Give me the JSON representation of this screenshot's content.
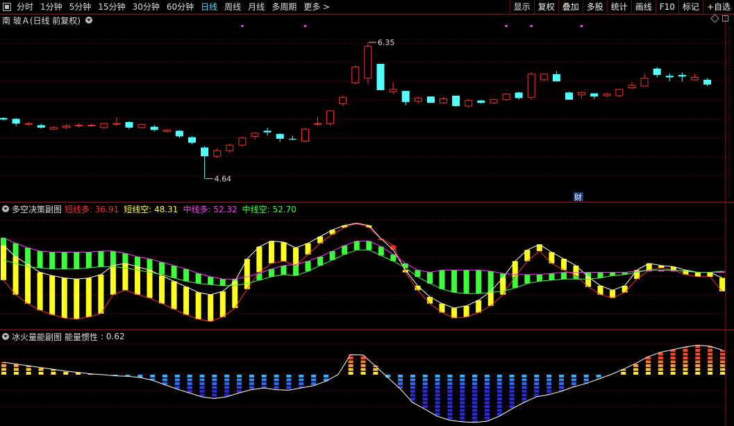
{
  "toolbar": {
    "periods": [
      "分时",
      "1分钟",
      "5分钟",
      "15分钟",
      "30分钟",
      "60分钟",
      "日线",
      "周线",
      "月线",
      "多周期",
      "更多 >"
    ],
    "active": "日线",
    "right_buttons": [
      "显示",
      "复权",
      "叠加",
      "多股",
      "统计",
      "画线",
      "F10",
      "标记",
      "+自选"
    ]
  },
  "main": {
    "title": "南 玻Ａ(日线 前复权)",
    "high_label": "6.35",
    "low_label": "4.64",
    "cai_label": "财",
    "colors": {
      "up": "#ff3232",
      "down": "#54ffff",
      "grid": "#7a1818"
    },
    "ylim": [
      4.4,
      6.55
    ],
    "candles": [
      [
        5.4,
        5.38,
        5.41,
        5.37
      ],
      [
        5.39,
        5.33,
        5.4,
        5.3
      ],
      [
        5.33,
        5.33,
        5.35,
        5.3
      ],
      [
        5.31,
        5.28,
        5.33,
        5.27
      ],
      [
        5.26,
        5.28,
        5.3,
        5.25
      ],
      [
        5.28,
        5.3,
        5.32,
        5.26
      ],
      [
        5.31,
        5.31,
        5.34,
        5.28
      ],
      [
        5.31,
        5.31,
        5.33,
        5.29
      ],
      [
        5.28,
        5.33,
        5.34,
        5.26
      ],
      [
        5.33,
        5.33,
        5.41,
        5.3
      ],
      [
        5.35,
        5.28,
        5.36,
        5.26
      ],
      [
        5.28,
        5.32,
        5.33,
        5.27
      ],
      [
        5.29,
        5.25,
        5.31,
        5.23
      ],
      [
        5.23,
        5.25,
        5.26,
        5.22
      ],
      [
        5.24,
        5.17,
        5.25,
        5.15
      ],
      [
        5.16,
        5.09,
        5.17,
        5.07
      ],
      [
        5.03,
        4.92,
        5.05,
        4.64
      ],
      [
        4.92,
        4.99,
        5.02,
        4.9
      ],
      [
        4.99,
        5.06,
        5.08,
        4.96
      ],
      [
        5.06,
        5.15,
        5.17,
        5.04
      ],
      [
        5.17,
        5.21,
        5.22,
        5.13
      ],
      [
        5.24,
        5.22,
        5.28,
        5.18
      ],
      [
        5.2,
        5.14,
        5.21,
        5.1
      ],
      [
        5.14,
        5.13,
        5.18,
        5.12
      ],
      [
        5.11,
        5.26,
        5.28,
        5.1
      ],
      [
        5.33,
        5.33,
        5.42,
        5.3
      ],
      [
        5.33,
        5.49,
        5.49,
        5.3
      ],
      [
        5.58,
        5.66,
        5.68,
        5.55
      ],
      [
        5.84,
        6.04,
        6.06,
        5.82
      ],
      [
        5.9,
        6.3,
        6.35,
        5.82
      ],
      [
        6.08,
        5.75,
        6.08,
        5.75
      ],
      [
        5.73,
        5.76,
        5.85,
        5.7
      ],
      [
        5.74,
        5.6,
        5.74,
        5.56
      ],
      [
        5.61,
        5.65,
        5.67,
        5.58
      ],
      [
        5.67,
        5.59,
        5.67,
        5.59
      ],
      [
        5.59,
        5.64,
        5.66,
        5.58
      ],
      [
        5.68,
        5.55,
        5.68,
        5.54
      ],
      [
        5.55,
        5.62,
        5.64,
        5.53
      ],
      [
        5.62,
        5.59,
        5.63,
        5.58
      ],
      [
        5.59,
        5.63,
        5.64,
        5.58
      ],
      [
        5.63,
        5.7,
        5.71,
        5.62
      ],
      [
        5.72,
        5.65,
        5.73,
        5.63
      ],
      [
        5.66,
        5.95,
        5.98,
        5.63
      ],
      [
        5.88,
        5.95,
        5.96,
        5.86
      ],
      [
        5.95,
        5.86,
        5.99,
        5.86
      ],
      [
        5.72,
        5.63,
        5.73,
        5.63
      ],
      [
        5.69,
        5.72,
        5.73,
        5.64
      ],
      [
        5.71,
        5.67,
        5.71,
        5.64
      ],
      [
        5.68,
        5.7,
        5.72,
        5.66
      ],
      [
        5.68,
        5.76,
        5.77,
        5.66
      ],
      [
        5.78,
        5.81,
        5.85,
        5.76
      ],
      [
        5.8,
        5.9,
        5.96,
        5.8
      ],
      [
        6.02,
        5.94,
        6.04,
        5.91
      ],
      [
        5.93,
        5.91,
        5.96,
        5.86
      ],
      [
        5.94,
        5.92,
        5.97,
        5.86
      ],
      [
        5.88,
        5.91,
        5.95,
        5.87
      ],
      [
        5.88,
        5.82,
        5.9,
        5.8
      ]
    ],
    "marks": [
      19,
      24,
      40,
      42,
      46
    ]
  },
  "dk": {
    "title": "多空决策副图",
    "legend": [
      {
        "name": "短线多",
        "value": "36.91",
        "color": "#ff3232"
      },
      {
        "name": "短线空",
        "value": "48.31",
        "color": "#ffff3c"
      },
      {
        "name": "中线多",
        "value": "52.32",
        "color": "#ff3cff"
      },
      {
        "name": "中线空",
        "value": "52.70",
        "color": "#3cff3c"
      }
    ],
    "ylim": [
      0,
      100
    ],
    "s1": [
      43,
      30,
      22,
      16,
      12,
      9,
      8,
      10,
      13,
      30,
      34,
      30,
      27,
      22,
      17,
      12,
      8,
      6,
      10,
      18,
      35,
      50,
      58,
      60,
      56,
      66,
      76,
      84,
      90,
      94,
      90,
      80,
      74,
      50,
      34,
      22,
      14,
      9,
      10,
      14,
      20,
      30,
      46,
      60,
      69,
      58,
      52,
      47,
      37,
      30,
      27,
      32,
      44,
      52,
      54,
      52,
      48,
      46,
      46,
      33
    ],
    "s2": [
      61,
      58,
      55,
      54,
      53,
      53,
      53,
      54,
      55,
      55,
      54,
      52,
      50,
      48,
      45,
      42,
      40,
      39,
      38,
      38,
      40,
      43,
      46,
      48,
      47,
      51,
      56,
      61,
      66,
      70,
      70,
      65,
      60,
      54,
      46,
      40,
      35,
      32,
      31,
      31,
      32,
      33,
      36,
      40,
      42,
      43,
      44,
      44,
      44,
      45,
      47,
      48,
      50,
      52,
      52,
      52,
      51,
      50,
      50,
      51
    ],
    "s3": [
      74,
      64,
      57,
      50,
      47,
      45,
      44,
      45,
      48,
      56,
      58,
      55,
      52,
      47,
      42,
      37,
      32,
      30,
      33,
      42,
      62,
      73,
      78,
      77,
      72,
      76,
      82,
      88,
      92,
      94,
      92,
      80,
      70,
      52,
      38,
      28,
      22,
      18,
      20,
      25,
      33,
      45,
      60,
      70,
      75,
      68,
      62,
      56,
      46,
      38,
      34,
      38,
      52,
      58,
      56,
      55,
      52,
      50,
      50,
      45
    ],
    "s4": [
      81,
      76,
      72,
      69,
      68,
      68,
      68,
      68,
      69,
      69,
      67,
      64,
      62,
      59,
      56,
      53,
      49,
      46,
      44,
      44,
      46,
      49,
      53,
      56,
      57,
      60,
      64,
      69,
      74,
      78,
      78,
      73,
      66,
      58,
      52,
      50,
      52,
      52,
      52,
      52,
      51,
      49,
      48,
      48,
      48,
      49,
      50,
      50,
      50,
      50,
      50,
      50,
      51,
      52,
      52,
      52,
      51,
      50,
      50,
      50
    ]
  },
  "ice": {
    "title": "冰火量能副图",
    "legend_name": "能量惯性",
    "legend_value": "0.62",
    "ylim": [
      -1,
      1
    ],
    "values": [
      0.28,
      0.24,
      0.2,
      0.16,
      0.12,
      0.08,
      0.05,
      0.02,
      0.0,
      -0.02,
      -0.03,
      -0.05,
      -0.1,
      -0.18,
      -0.26,
      -0.33,
      -0.4,
      -0.43,
      -0.4,
      -0.33,
      -0.27,
      -0.24,
      -0.27,
      -0.28,
      -0.24,
      -0.2,
      -0.12,
      0.0,
      0.45,
      0.44,
      0.2,
      -0.05,
      -0.25,
      -0.5,
      -0.62,
      -0.75,
      -0.82,
      -0.85,
      -0.86,
      -0.84,
      -0.75,
      -0.62,
      -0.5,
      -0.4,
      -0.36,
      -0.3,
      -0.22,
      -0.16,
      -0.08,
      0.0,
      0.12,
      0.25,
      0.4,
      0.5,
      0.56,
      0.62,
      0.66,
      0.64,
      0.55
    ]
  }
}
